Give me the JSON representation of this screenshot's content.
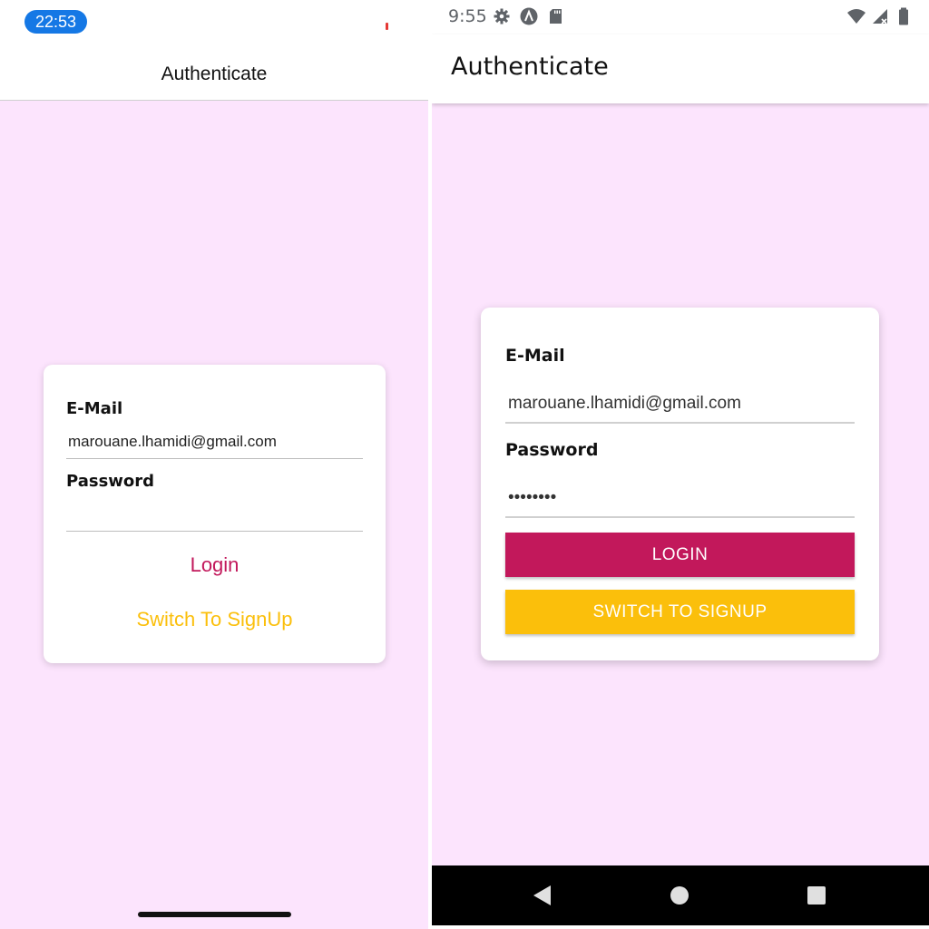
{
  "ios": {
    "status": {
      "time": "22:53"
    },
    "header": {
      "title": "Authenticate"
    },
    "form": {
      "email_label": "E-Mail",
      "email_value": "marouane.lhamidi@gmail.com",
      "password_label": "Password",
      "password_value": "",
      "login_label": "Login",
      "switch_label": "Switch To SignUp"
    }
  },
  "android": {
    "status": {
      "time": "9:55",
      "left_icons": [
        "settings-icon",
        "assistant-icon",
        "sd-card-icon"
      ],
      "right_icons": [
        "wifi-icon",
        "cellular-signal-icon",
        "battery-icon"
      ]
    },
    "header": {
      "title": "Authenticate"
    },
    "form": {
      "email_label": "E-Mail",
      "email_value": "marouane.lhamidi@gmail.com",
      "password_label": "Password",
      "password_value": "••••••••",
      "login_label": "LOGIN",
      "switch_label": "SWITCH TO SIGNUP"
    },
    "navbar": [
      "back-icon",
      "home-icon",
      "recents-icon"
    ]
  },
  "colors": {
    "background": "#fce4fd",
    "primary": "#c2185b",
    "accent": "#fbbf0b",
    "ios_time_pill": "#1578e5"
  }
}
